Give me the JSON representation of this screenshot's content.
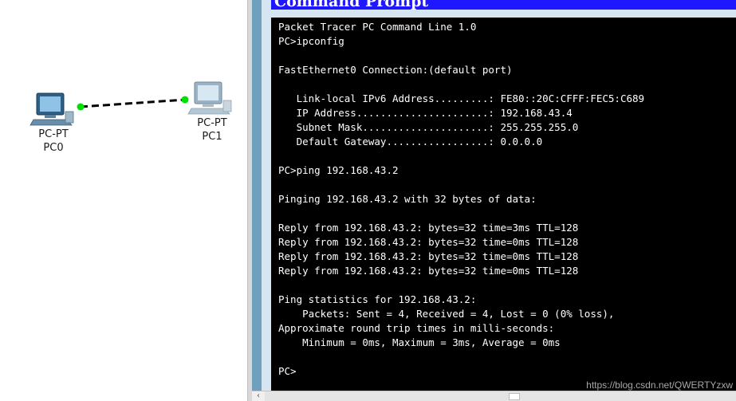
{
  "window": {
    "title": "Command Prompt"
  },
  "topology": {
    "devices": [
      {
        "id": "pc0",
        "type_label": "PC-PT",
        "name": "PC0",
        "icon": "pc-icon"
      },
      {
        "id": "pc1",
        "type_label": "PC-PT",
        "name": "PC1",
        "icon": "pc-icon"
      }
    ],
    "link": {
      "style": "dashed",
      "status_color": "#00e000"
    }
  },
  "terminal": {
    "lines": [
      "Packet Tracer PC Command Line 1.0",
      "PC>ipconfig",
      "",
      "FastEthernet0 Connection:(default port)",
      "",
      "   Link-local IPv6 Address.........: FE80::20C:CFFF:FEC5:C689",
      "   IP Address......................: 192.168.43.4",
      "   Subnet Mask.....................: 255.255.255.0",
      "   Default Gateway.................: 0.0.0.0",
      "",
      "PC>ping 192.168.43.2",
      "",
      "Pinging 192.168.43.2 with 32 bytes of data:",
      "",
      "Reply from 192.168.43.2: bytes=32 time=3ms TTL=128",
      "Reply from 192.168.43.2: bytes=32 time=0ms TTL=128",
      "Reply from 192.168.43.2: bytes=32 time=0ms TTL=128",
      "Reply from 192.168.43.2: bytes=32 time=0ms TTL=128",
      "",
      "Ping statistics for 192.168.43.2:",
      "    Packets: Sent = 4, Received = 4, Lost = 0 (0% loss),",
      "Approximate round trip times in milli-seconds:",
      "    Minimum = 0ms, Maximum = 3ms, Average = 0ms",
      "",
      "PC>"
    ]
  },
  "watermark": "https://blog.csdn.net/QWERTYzxw",
  "colors": {
    "title_bar": "#1f17ff",
    "terminal_bg": "#000000",
    "terminal_fg": "#ffffff",
    "frame": "#6fa0be",
    "link_light": "#00e000"
  }
}
